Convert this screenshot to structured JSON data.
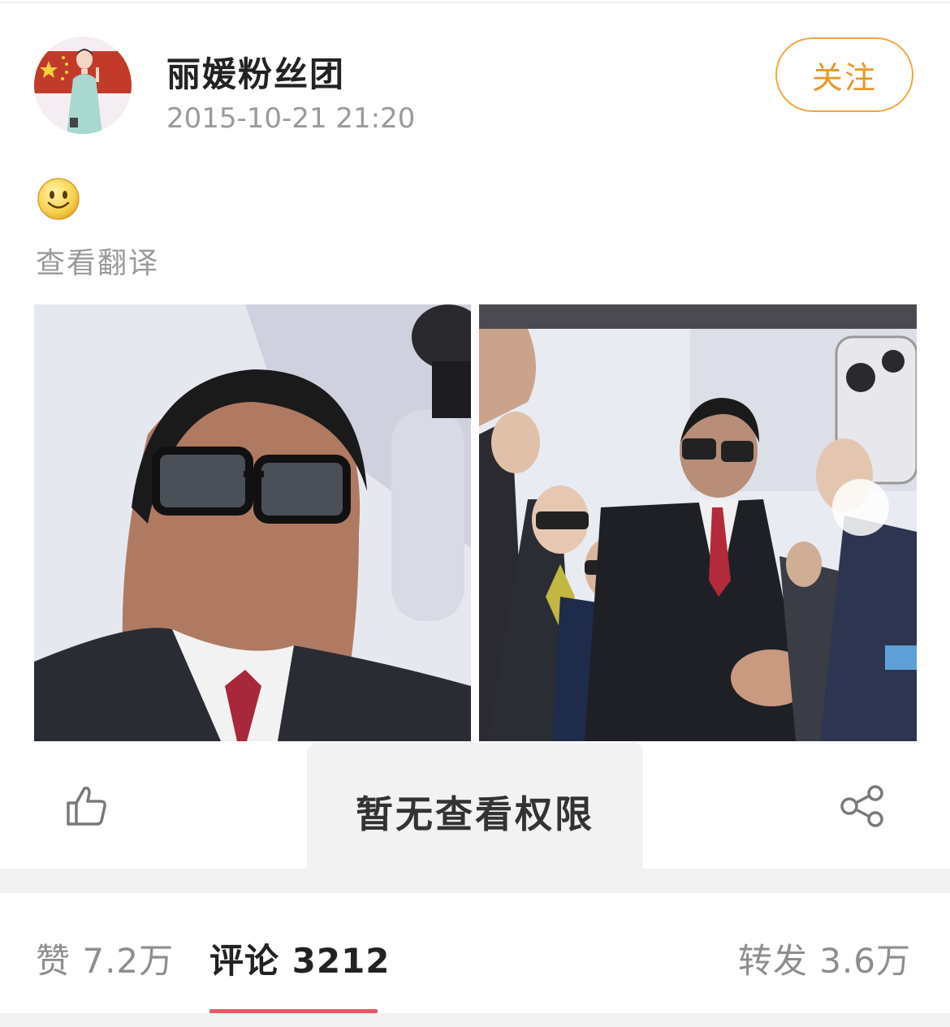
{
  "post": {
    "author": "丽媛粉丝团",
    "timestamp": "2015-10-21 21:20",
    "follow_label": "关注",
    "content_emoji": "smile-emoji",
    "translate_label": "查看翻译",
    "images": [
      "photo-1",
      "photo-2"
    ]
  },
  "toast": {
    "message": "暂无查看权限"
  },
  "stats": {
    "likes_label": "赞 7.2万",
    "comments_label": "评论 3212",
    "reposts_label": "转发 3.6万",
    "active_tab": "comments"
  },
  "colors": {
    "accent": "#e8962a",
    "tab_indicator": "#e85a6a",
    "muted_text": "#9a9a9a"
  },
  "icons": {
    "like": "thumbs-up-icon",
    "share": "share-icon"
  }
}
